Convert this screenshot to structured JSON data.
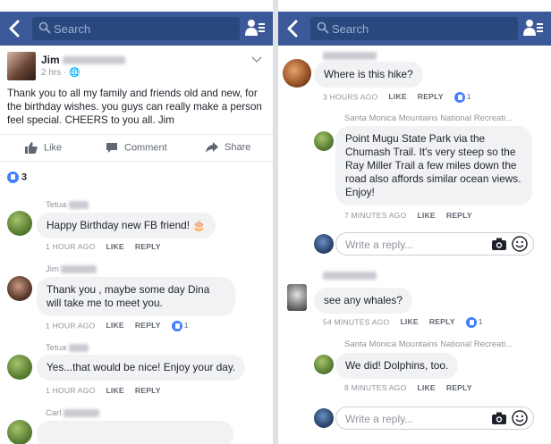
{
  "colors": {
    "nav": "#3b5998",
    "search_bg": "#29487d",
    "bubble": "#f1f2f4",
    "like_blue": "#4080ff",
    "meta_gray": "#90949c"
  },
  "left": {
    "search_placeholder": "Search",
    "post": {
      "author": "Jim",
      "time": "2 hrs · ",
      "text": "Thank you to all my family and friends old and new, for the birthday wishes. you guys can really make a person feel special. CHEERS to you all. Jim",
      "actions": {
        "like": "Like",
        "comment": "Comment",
        "share": "Share"
      },
      "like_count": "3"
    },
    "comments": [
      {
        "author": "Tetua",
        "text": "Happy Birthday new FB friend! 🎂",
        "time": "1 HOUR AGO",
        "like": "LIKE",
        "reply": "REPLY",
        "likes": ""
      },
      {
        "author": "Jim",
        "text": "Thank you , maybe some day Dina will take me to meet you.",
        "time": "1 HOUR AGO",
        "like": "LIKE",
        "reply": "REPLY",
        "likes": "1"
      },
      {
        "author": "Tetua",
        "text": "Yes...that would be nice! Enjoy your day.",
        "time": "1 HOUR AGO",
        "like": "LIKE",
        "reply": "REPLY",
        "likes": ""
      },
      {
        "author": "Carl",
        "text": "",
        "time": "",
        "like": "",
        "reply": "",
        "likes": ""
      }
    ]
  },
  "right": {
    "search_placeholder": "Search",
    "comments": [
      {
        "author": "",
        "text": "Where is this hike?",
        "time": "3 HOURS AGO",
        "like": "LIKE",
        "reply": "REPLY",
        "likes": "1"
      },
      {
        "author": "Santa Monica Mountains National Recreati...",
        "text": "Point Mugu State Park via the Chumash Trail. It's very steep so the Ray Miller Trail a few miles down the road also affords similar ocean views. Enjoy!",
        "time": "7 MINUTES AGO",
        "like": "LIKE",
        "reply": "REPLY",
        "likes": ""
      },
      {
        "author": "",
        "text": "see any whales?",
        "time": "54 MINUTES AGO",
        "like": "LIKE",
        "reply": "REPLY",
        "likes": "1"
      },
      {
        "author": "Santa Monica Mountains National Recreati...",
        "text": "We did! Dolphins, too.",
        "time": "8 MINUTES AGO",
        "like": "LIKE",
        "reply": "REPLY",
        "likes": ""
      }
    ],
    "reply_placeholder": "Write a reply..."
  },
  "icons": [
    "back-arrow-icon",
    "search-icon",
    "friend-requests-icon",
    "chevron-down-icon",
    "globe-icon",
    "like-thumb-icon",
    "comment-icon",
    "share-icon",
    "like-reaction-icon",
    "camera-icon",
    "emoji-icon"
  ]
}
